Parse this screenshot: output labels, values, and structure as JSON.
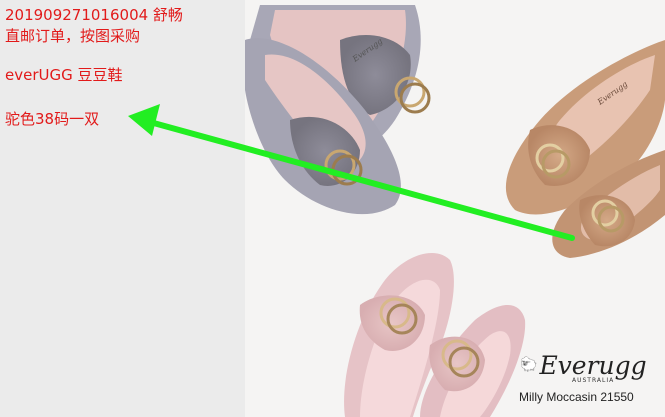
{
  "notes": {
    "order_line": "201909271016004  舒畅",
    "instruction": "直邮订单，按图采购",
    "brand_line": "everUGG  豆豆鞋",
    "spec_line": "驼色38码一双"
  },
  "photo": {
    "brand_logo": "Everugg",
    "brand_subtitle": "AUSTRALIA",
    "product_caption": "Milly Moccasin 21550",
    "sole_label": "Everugg"
  },
  "colors": {
    "note_text": "#e21a1a",
    "arrow": "#22ee22",
    "shoe_grey": "#a8a7b6",
    "shoe_camel": "#c89a78",
    "shoe_pink": "#e6c3c7"
  }
}
